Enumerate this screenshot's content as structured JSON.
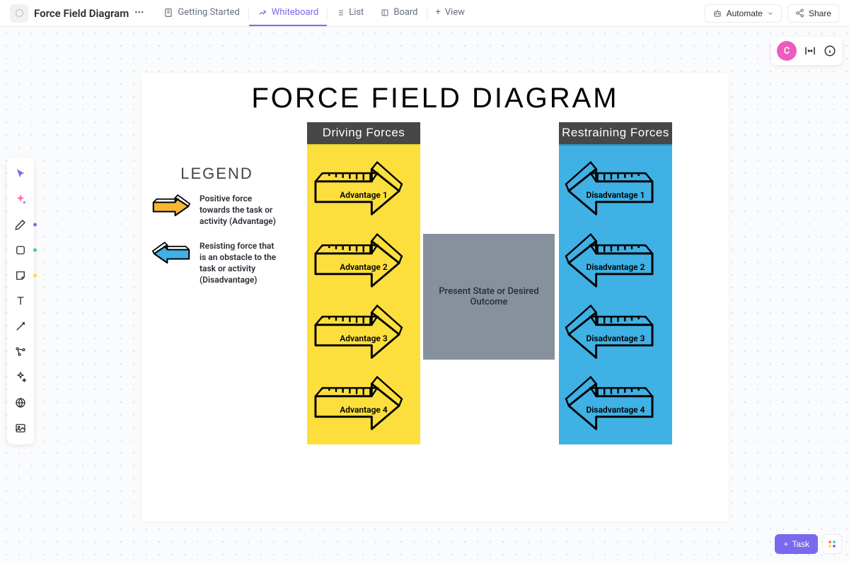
{
  "header": {
    "title": "Force Field Diagram",
    "tabs": {
      "getting_started": "Getting Started",
      "whiteboard": "Whiteboard",
      "list": "List",
      "board": "Board",
      "view": "View"
    },
    "automate": "Automate",
    "share": "Share"
  },
  "avatar_letter": "C",
  "diagram": {
    "title": "FORCE FIELD  DIAGRAM",
    "legend_title": "LEGEND",
    "legend_positive": "Positive force towards the task or activity (Advantage)",
    "legend_negative": "Resisting force that is an obstacle to the task or activity (Disadvantage)",
    "driving_header": "Driving Forces",
    "restraining_header": "Restraining Forces",
    "center_text": "Present State or Desired Outcome",
    "advantages": [
      "Advantage 1",
      "Advantage 2",
      "Advantage 3",
      "Advantage 4"
    ],
    "disadvantages": [
      "Disadvantage 1",
      "Disadvantage 2",
      "Disadvantage 3",
      "Disadvantage 4"
    ]
  },
  "task_button": "Task"
}
